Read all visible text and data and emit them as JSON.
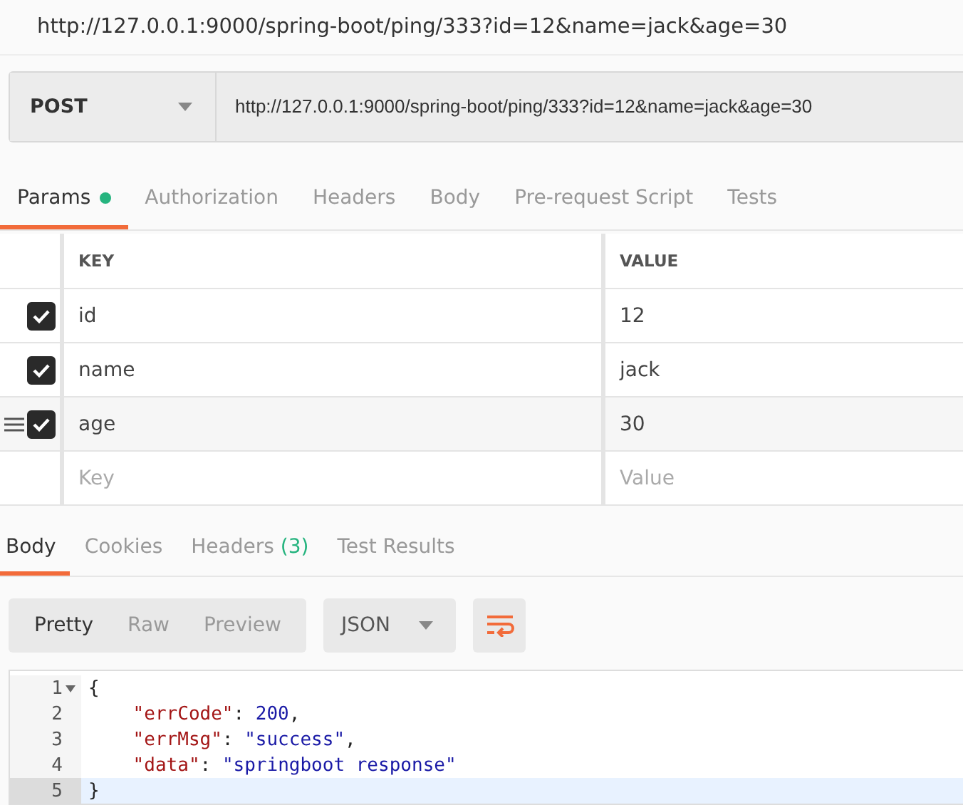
{
  "window": {
    "title": "http://127.0.0.1:9000/spring-boot/ping/333?id=12&name=jack&age=30"
  },
  "request": {
    "method": "POST",
    "url": "http://127.0.0.1:9000/spring-boot/ping/333?id=12&name=jack&age=30"
  },
  "request_tabs": [
    {
      "label": "Params",
      "selected": true,
      "dot": true
    },
    {
      "label": "Authorization",
      "selected": false,
      "dot": false
    },
    {
      "label": "Headers",
      "selected": false,
      "dot": false
    },
    {
      "label": "Body",
      "selected": false,
      "dot": false
    },
    {
      "label": "Pre-request Script",
      "selected": false,
      "dot": false
    },
    {
      "label": "Tests",
      "selected": false,
      "dot": false
    }
  ],
  "params": {
    "columns": [
      "KEY",
      "VALUE"
    ],
    "rows": [
      {
        "key": "id",
        "value": "12",
        "checked": true,
        "hovered": false
      },
      {
        "key": "name",
        "value": "jack",
        "checked": true,
        "hovered": false
      },
      {
        "key": "age",
        "value": "30",
        "checked": true,
        "hovered": true
      }
    ],
    "new_row": {
      "key_placeholder": "Key",
      "value_placeholder": "Value"
    }
  },
  "response_tabs": [
    {
      "label": "Body",
      "selected": true
    },
    {
      "label": "Cookies",
      "selected": false
    },
    {
      "label": "Headers",
      "count": "(3)",
      "selected": false
    },
    {
      "label": "Test Results",
      "selected": false
    }
  ],
  "view_modes": [
    {
      "label": "Pretty",
      "selected": true
    },
    {
      "label": "Raw",
      "selected": false
    },
    {
      "label": "Preview",
      "selected": false
    }
  ],
  "format": "JSON",
  "code": [
    {
      "number": "1",
      "fold": true,
      "current": false,
      "parts": [
        {
          "kind": "punct",
          "text": "{"
        }
      ]
    },
    {
      "number": "2",
      "fold": false,
      "current": false,
      "parts": [
        {
          "kind": "key",
          "text": "    \"errCode\""
        },
        {
          "kind": "punct",
          "text": ": "
        },
        {
          "kind": "number",
          "text": "200"
        },
        {
          "kind": "punct",
          "text": ","
        }
      ]
    },
    {
      "number": "3",
      "fold": false,
      "current": false,
      "parts": [
        {
          "kind": "key",
          "text": "    \"errMsg\""
        },
        {
          "kind": "punct",
          "text": ": "
        },
        {
          "kind": "string",
          "text": "\"success\""
        },
        {
          "kind": "punct",
          "text": ","
        }
      ]
    },
    {
      "number": "4",
      "fold": false,
      "current": false,
      "parts": [
        {
          "kind": "key",
          "text": "    \"data\""
        },
        {
          "kind": "punct",
          "text": ": "
        },
        {
          "kind": "string",
          "text": "\"springboot response\""
        }
      ]
    },
    {
      "number": "5",
      "fold": false,
      "current": true,
      "parts": [
        {
          "kind": "punct",
          "text": "}"
        }
      ]
    }
  ]
}
